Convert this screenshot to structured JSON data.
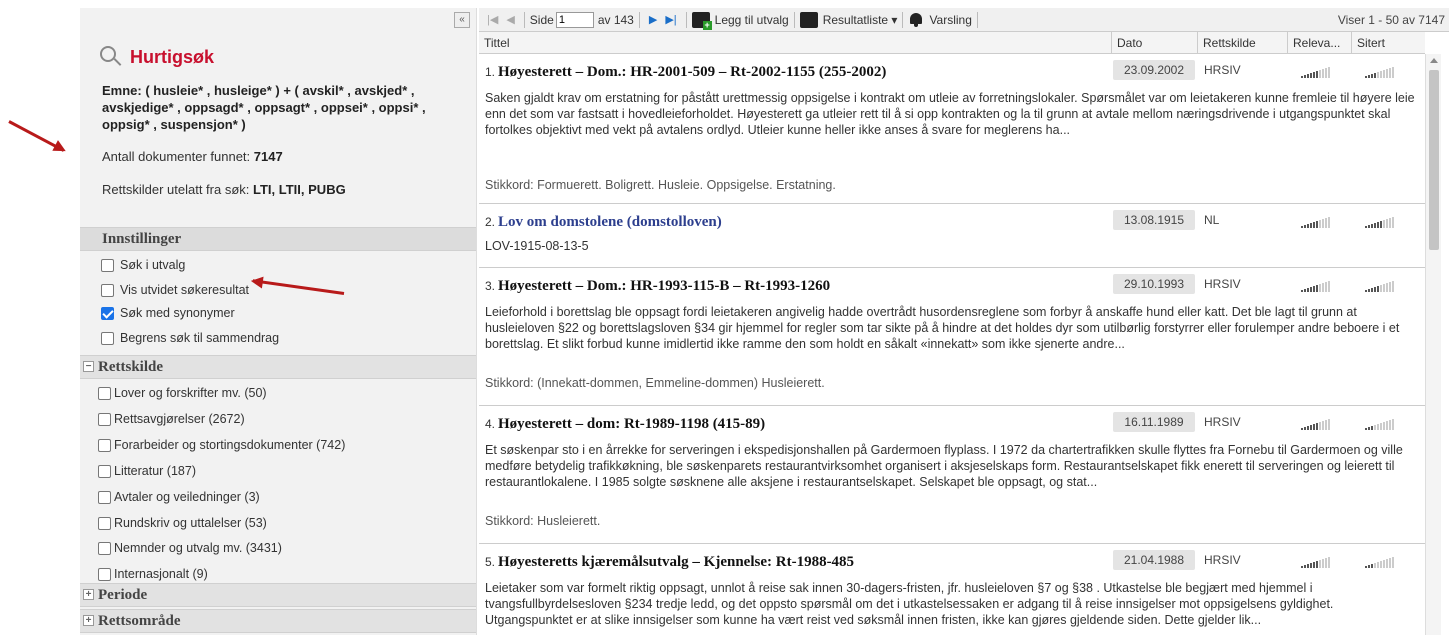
{
  "quicksearch": {
    "title": "Hurtigsøk",
    "query": "Emne: ( husleie* , husleige* ) + ( avskil* , avskjed* , avskjedige* , oppsagd* , oppsagt* , oppsei* , oppsi* , oppsig* , suspensjon* )",
    "found_label": "Antall dokumenter funnet:",
    "found_value": "7147",
    "excluded_label": "Rettskilder utelatt fra søk:",
    "excluded_value": "LTI, LTII, PUBG"
  },
  "settings": {
    "header": "Innstillinger",
    "options": [
      {
        "label": "Søk i utvalg",
        "checked": false
      },
      {
        "label": "Vis utvidet søkeresultat",
        "checked": false
      },
      {
        "label": "Søk med synonymer",
        "checked": true
      },
      {
        "label": "Begrens søk til sammendrag",
        "checked": false
      }
    ]
  },
  "rettskilde": {
    "header": "Rettskilde",
    "toggle": "−",
    "items": [
      "Lover og forskrifter mv. (50)",
      "Rettsavgjørelser (2672)",
      "Forarbeider og stortingsdokumenter (742)",
      "Litteratur (187)",
      "Avtaler og veiledninger (3)",
      "Rundskriv og uttalelser (53)",
      "Nemnder og utvalg mv. (3431)",
      "Internasjonalt (9)"
    ]
  },
  "periode": {
    "header": "Periode",
    "toggle": "+"
  },
  "rettsomrade": {
    "header": "Rettsområde",
    "toggle": "+"
  },
  "toolbar": {
    "page_label": "Side",
    "page_value": "1",
    "page_of": "av 143",
    "add_selection": "Legg til utvalg",
    "result_list": "Resultatliste ▾",
    "alert": "Varsling",
    "showing": "Viser 1 - 50 av 7147"
  },
  "columns": {
    "title": "Tittel",
    "date": "Dato",
    "source": "Rettskilde",
    "relevance": "Releva...",
    "cited": "Sitert"
  },
  "results": [
    {
      "num": "1.",
      "title": "Høyesterett – Dom.: HR-2001-509 – Rt-2002-1155 (255-2002)",
      "date": "23.09.2002",
      "source": "HRSIV",
      "relevance": 0.6,
      "cited": 0.4,
      "body": "Saken gjaldt krav om erstatning for påstått urettmessig oppsigelse i kontrakt om utleie av forretningslokaler. Spørsmålet var om leietakeren kunne fremleie til høyere leie enn det som var fastsatt i hovedleieforholdet. Høyesterett ga utleier rett til å si opp kontrakten og la til grunn at avtale mellom næringsdrivende i utgangspunktet skal fortolkes objektivt med vekt på avtalens ordlyd. Utleier kunne heller ikke anses å svare for meglerens ha...",
      "keywords": "Stikkord: Formuerett. Boligrett. Husleie. Oppsigelse. Erstatning."
    },
    {
      "num": "2.",
      "title": "Lov om domstolene (domstolloven)",
      "date": "13.08.1915",
      "source": "NL",
      "relevance": 0.6,
      "cited": 0.6,
      "body": "LOV-1915-08-13-5",
      "keywords": ""
    },
    {
      "num": "3.",
      "title": "Høyesterett – Dom.: HR-1993-115-B – Rt-1993-1260",
      "date": "29.10.1993",
      "source": "HRSIV",
      "relevance": 0.6,
      "cited": 0.5,
      "body": "Leieforhold i borettslag ble oppsagt fordi leietakeren angivelig hadde overtrådt husordensreglene som forbyr å anskaffe hund eller katt. Det ble lagt til grunn at husleieloven §22 og borettslagsloven §34 gir hjemmel for regler som tar sikte på å hindre at det holdes dyr som utilbørlig forstyrrer eller forulemper andre beboere i et borettslag. Et slikt forbud kunne imidlertid ikke ramme den som holdt en såkalt «innekatt» som ikke sjenerte andre...",
      "keywords": "Stikkord: (Innekatt-dommen, Emmeline-dommen) Husleierett."
    },
    {
      "num": "4.",
      "title": "Høyesterett – dom: Rt-1989-1198 (415-89)",
      "date": "16.11.1989",
      "source": "HRSIV",
      "relevance": 0.6,
      "cited": 0.3,
      "body": "Et søskenpar sto i en årrekke for serveringen i ekspedisjonshallen på Gardermoen flyplass. I 1972 da chartertrafikken skulle flyttes fra Fornebu til Gardermoen og ville medføre betydelig trafikkøkning, ble søskenparets restaurantvirksomhet organisert i aksjeselskaps form. Restaurantselskapet fikk enerett til serveringen og leierett til restaurantlokalene. I 1985 solgte søsknene alle aksjene i restaurantselskapet. Selskapet ble oppsagt, og stat...",
      "keywords": "Stikkord: Husleierett."
    },
    {
      "num": "5.",
      "title": "Høyesteretts kjæremålsutvalg – Kjennelse: Rt-1988-485",
      "date": "21.04.1988",
      "source": "HRSIV",
      "relevance": 0.6,
      "cited": 0.3,
      "body": "Leietaker som var formelt riktig oppsagt, unnlot å reise sak innen 30-dagers-fristen, jfr. husleieloven §7 og §38 . Utkastelse ble begjært med hjemmel i tvangsfullbyrdelsesloven §234 tredje ledd, og det oppsto spørsmål om det i utkastelsessaken er adgang til å reise innsigelser mot oppsigelsens gyldighet. Utgangspunktet er at slike innsigelser som kunne ha vært reist ved søksmål innen fristen, ikke kan gjøres gjeldende siden. Dette gjelder lik...",
      "keywords": ""
    }
  ],
  "colors": {
    "brand_red": "#c8102e",
    "arrow_red": "#b81a1a",
    "link_blue": "#2d3f8e",
    "check_blue": "#1a73e8"
  }
}
